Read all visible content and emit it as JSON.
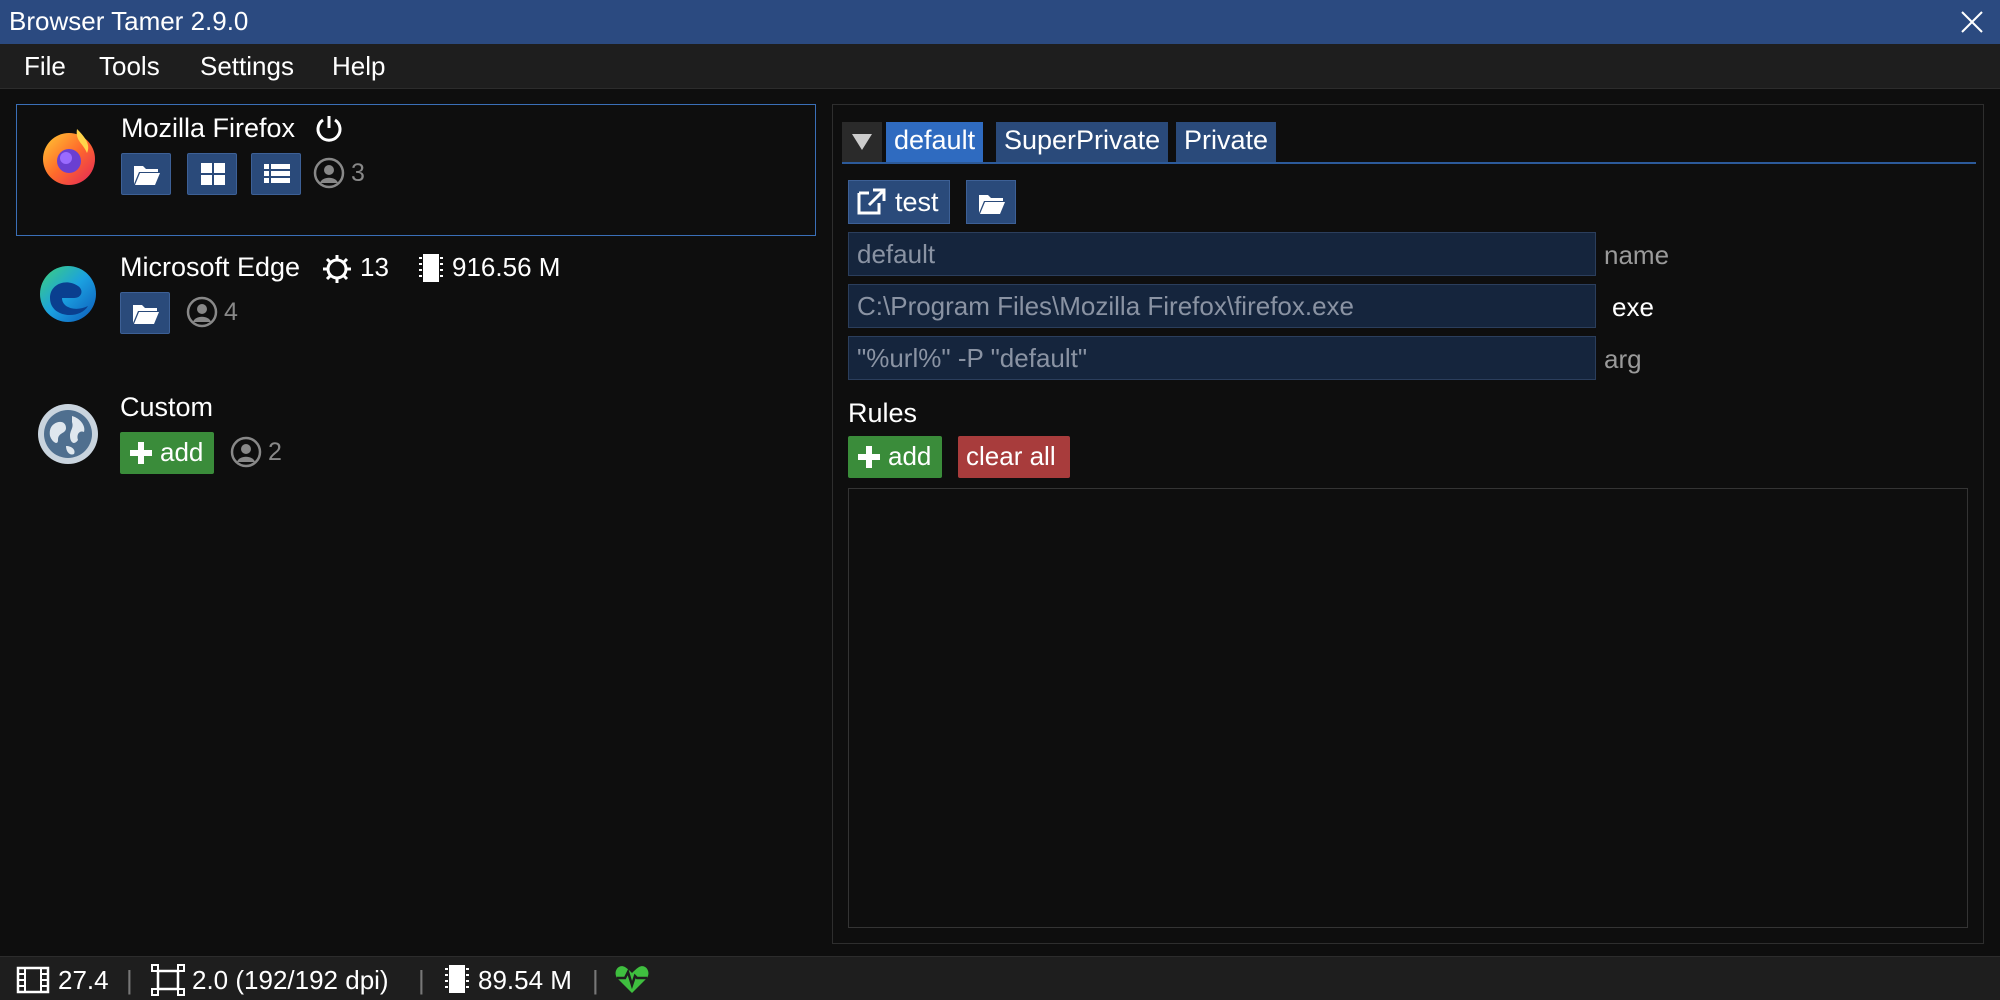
{
  "window": {
    "title": "Browser Tamer 2.9.0"
  },
  "menu": [
    "File",
    "Tools",
    "Settings",
    "Help"
  ],
  "browsers": [
    {
      "name": "Mozilla Firefox",
      "icon": "firefox-logo",
      "profiles": "3",
      "running_icon": "power-icon"
    },
    {
      "name": "Microsoft Edge",
      "icon": "edge-logo",
      "processes": "13",
      "memory": "916.56 M",
      "profiles": "4"
    },
    {
      "name": "Custom",
      "icon": "globe-logo",
      "add_label": "add",
      "profiles": "2"
    }
  ],
  "profile_tabs": [
    "default",
    "SuperPrivate",
    "Private"
  ],
  "active_tab": "default",
  "actions": {
    "test_label": "test"
  },
  "profile": {
    "name_value": "default",
    "name_label": "name",
    "exe_value": "C:\\Program Files\\Mozilla Firefox\\firefox.exe",
    "exe_label": "exe",
    "arg_value": "\"%url%\" -P \"default\"",
    "arg_label": "arg"
  },
  "rules": {
    "title": "Rules",
    "add_label": "add",
    "clear_label": "clear all"
  },
  "status": {
    "fps": "27.4",
    "scale": "2.0 (192/192 dpi)",
    "memory": "89.54 M",
    "separator": "|"
  },
  "colors": {
    "accent": "#2f6bc0",
    "titlebar": "#2b4a80",
    "add": "#3a8c3a",
    "danger": "#a83c3c",
    "health": "#3fbf3f"
  }
}
